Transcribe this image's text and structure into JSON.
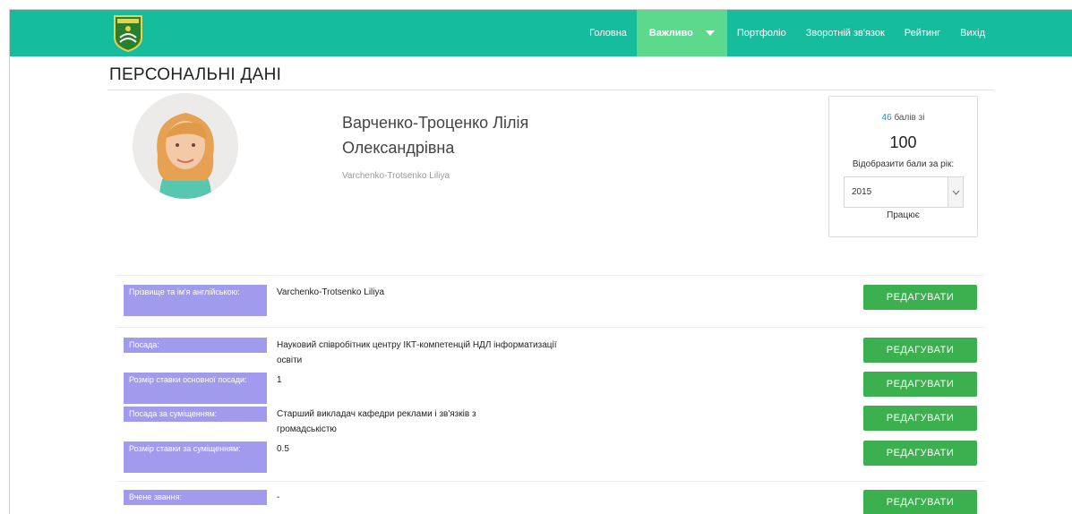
{
  "nav": {
    "items": [
      {
        "label": "Головна",
        "active": false
      },
      {
        "label": "Важливо",
        "active": true,
        "dropdown": true
      },
      {
        "label": "Портфоліо",
        "active": false
      },
      {
        "label": "Зворотній зв'язок",
        "active": false
      },
      {
        "label": "Рейтинг",
        "active": false
      },
      {
        "label": "Вихід",
        "active": false
      }
    ]
  },
  "colors": {
    "navbar": "#16bd9d",
    "nav_active": "#5cd98c",
    "label_bg": "#a09bec",
    "button": "#3cb04f",
    "score": "#2f8ed0"
  },
  "page": {
    "title": "ПЕРСОНАЛЬНІ ДАНІ"
  },
  "profile": {
    "name_line1": "Варченко-Троценко Лілія",
    "name_line2": "Олександрівна",
    "name_en": "Varchenko-Trotsenko Liliya"
  },
  "score": {
    "value": "46",
    "of_text": "балів зі",
    "max": "100",
    "year_label": "Відобразити бали за рік:",
    "year": "2015",
    "status": "Працює"
  },
  "fields": [
    {
      "label": "Прізвище та ім'я англійською:",
      "value": "Varchenko-Trotsenko Liliya",
      "button": "РЕДАГУВАТИ"
    },
    {
      "label": "Посада:",
      "value": "Науковий співробітник центру ІКТ-компетенцій НДЛ інформатизації освіти",
      "button": "РЕДАГУВАТИ"
    },
    {
      "label": "Розмір ставки основної посади:",
      "value": "1",
      "button": "РЕДАГУВАТИ"
    },
    {
      "label": "Посада за суміщенням:",
      "value": "Старший викладач кафедри реклами і зв'язків з громадськістю",
      "button": "РЕДАГУВАТИ"
    },
    {
      "label": "Розмір ставки за суміщенням:",
      "value": "0.5",
      "button": "РЕДАГУВАТИ"
    },
    {
      "label": "Вчене звання:",
      "value": "-",
      "button": "РЕДАГУВАТИ"
    }
  ]
}
